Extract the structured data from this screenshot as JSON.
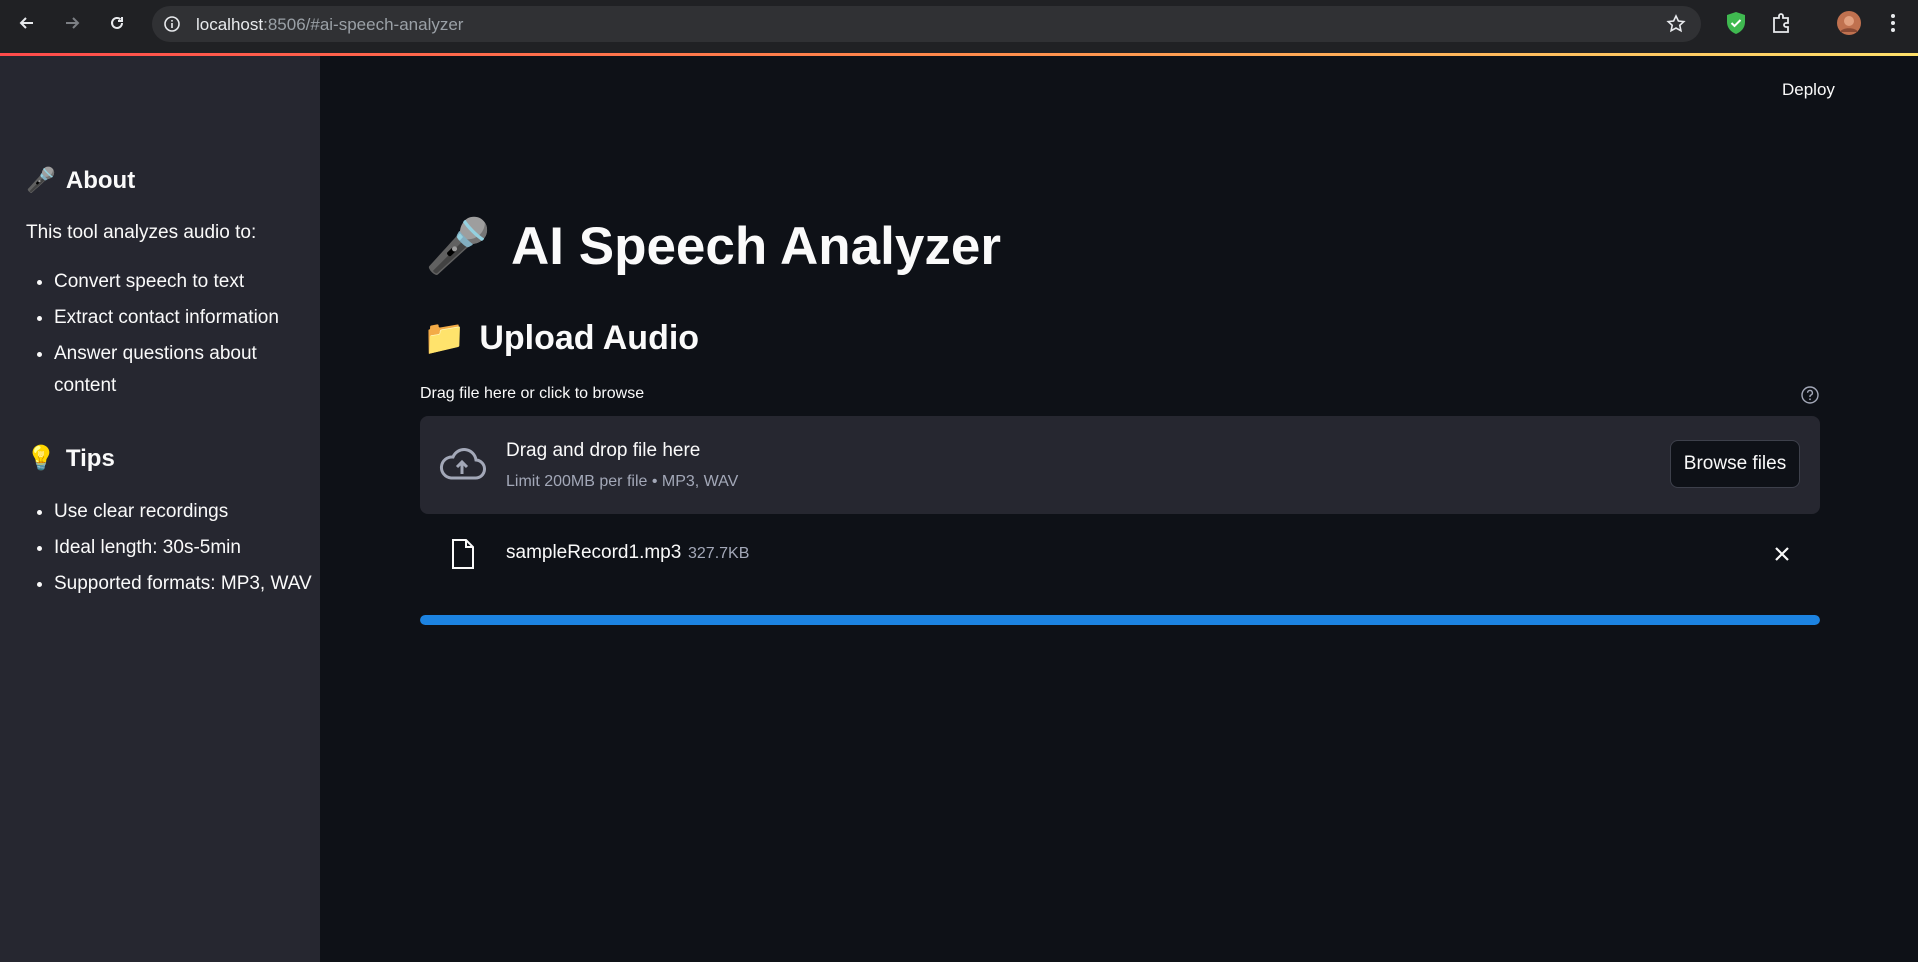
{
  "browser": {
    "url_host": "localhost",
    "url_rest": ":8506/#ai-speech-analyzer"
  },
  "header": {
    "deploy_label": "Deploy"
  },
  "sidebar": {
    "about": {
      "emoji": "🎤",
      "heading": "About",
      "intro": "This tool analyzes audio to:",
      "items": [
        "Convert speech to text",
        "Extract contact information",
        "Answer questions about content"
      ]
    },
    "tips": {
      "emoji": "💡",
      "heading": "Tips",
      "items": [
        "Use clear recordings",
        "Ideal length: 30s-5min",
        "Supported formats: MP3, WAV"
      ]
    }
  },
  "main": {
    "title_emoji": "🎤",
    "title": "AI Speech Analyzer",
    "upload_emoji": "📁",
    "upload_heading": "Upload Audio",
    "uploader_label": "Drag file here or click to browse",
    "dropzone_title": "Drag and drop file here",
    "dropzone_subtitle": "Limit 200MB per file • MP3, WAV",
    "browse_label": "Browse files",
    "file": {
      "name": "sampleRecord1.mp3",
      "size": "327.7KB"
    },
    "progress_percent": 100
  },
  "colors": {
    "accent": "#1c83e1",
    "sidebar_bg": "#262730",
    "page_bg": "#0e1117"
  }
}
